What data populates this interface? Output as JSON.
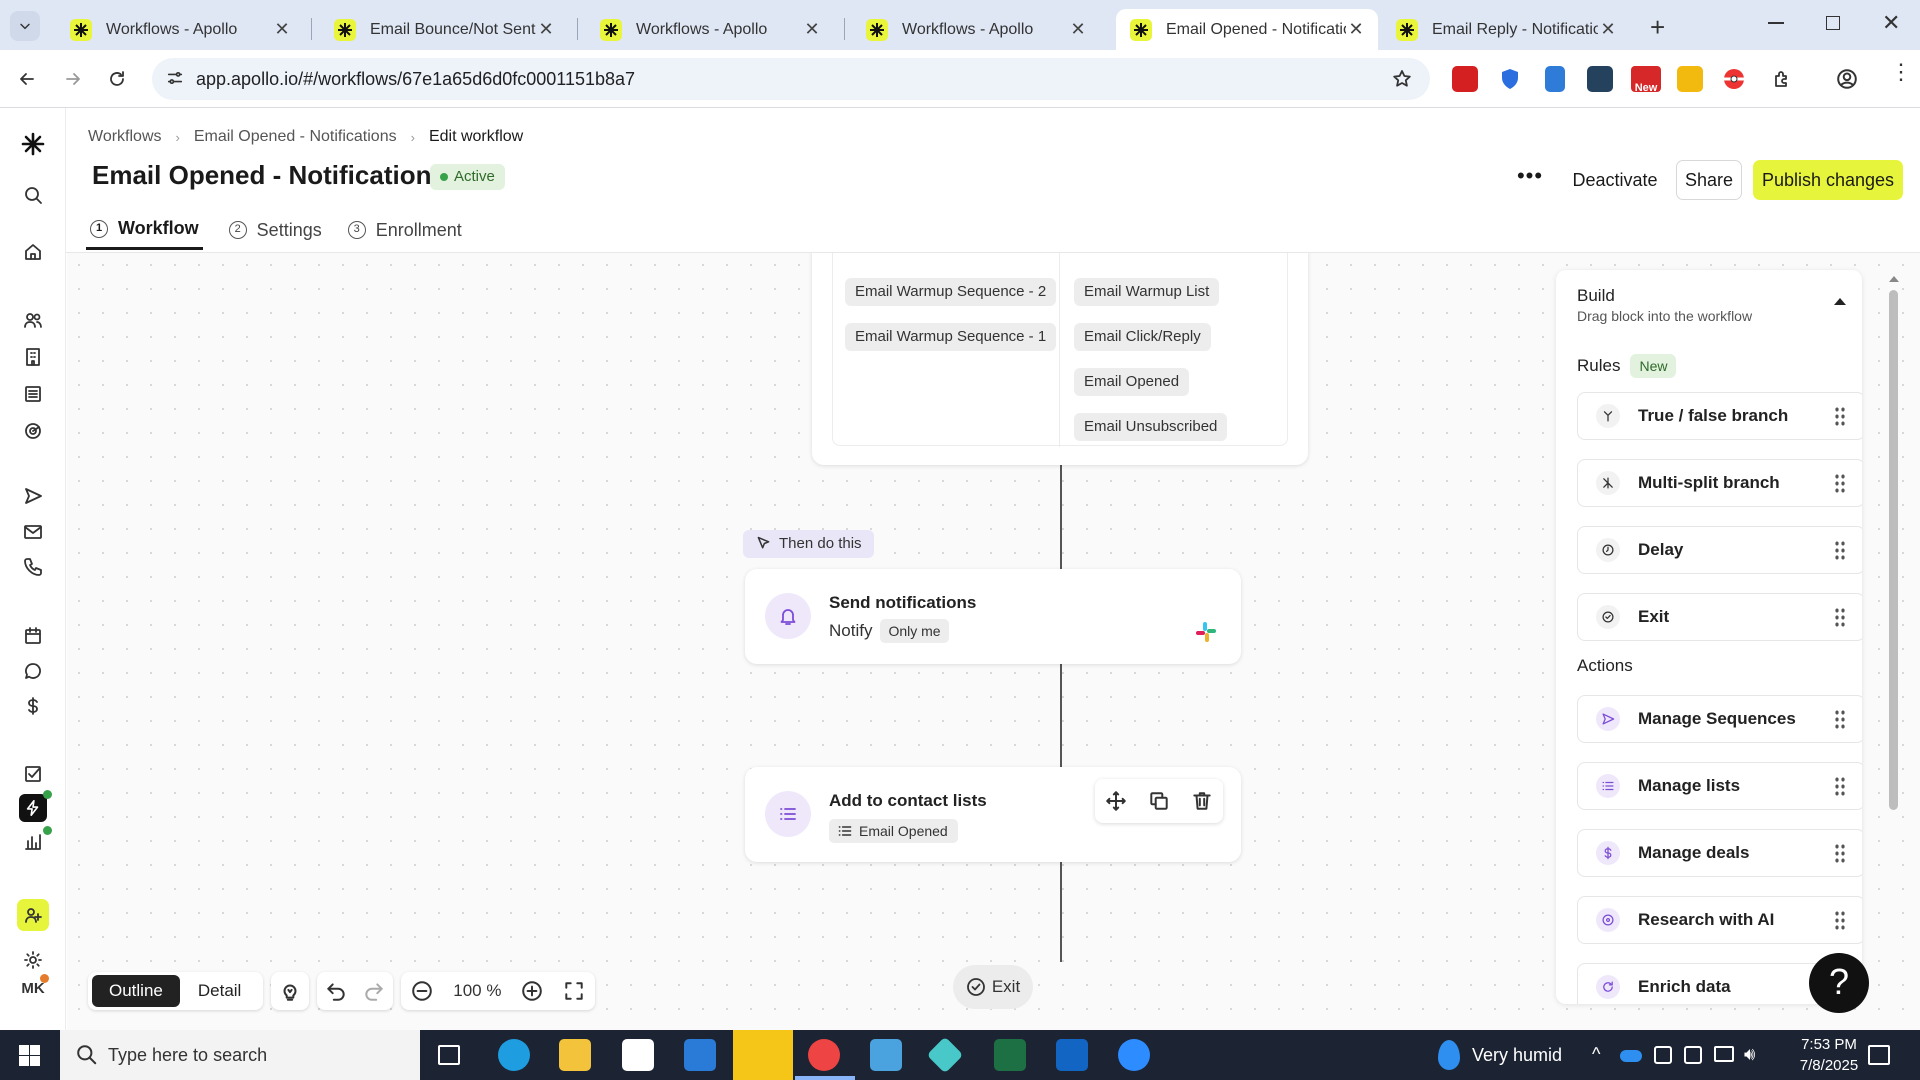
{
  "browser": {
    "tabs": [
      {
        "title": "Workflows - Apollo",
        "active": false
      },
      {
        "title": "Email Bounce/Not Sent - N",
        "active": false
      },
      {
        "title": "Workflows - Apollo",
        "active": false
      },
      {
        "title": "Workflows - Apollo",
        "active": false
      },
      {
        "title": "Email Opened - Notificatio",
        "active": true
      },
      {
        "title": "Email Reply - Notifications",
        "active": false
      }
    ],
    "url": "app.apollo.io/#/workflows/67e1a65d6d0fc0001151b8a7",
    "ext_badge": "New"
  },
  "breadcrumb": [
    "Workflows",
    "Email Opened - Notifications",
    "Edit workflow"
  ],
  "header": {
    "title": "Email Opened - Notifications",
    "status": "Active",
    "deactivate": "Deactivate",
    "share": "Share",
    "publish": "Publish changes"
  },
  "workflow_tabs": [
    {
      "num": "1",
      "label": "Workflow"
    },
    {
      "num": "2",
      "label": "Settings"
    },
    {
      "num": "3",
      "label": "Enrollment"
    }
  ],
  "canvas": {
    "trigger_chips_left": [
      "Email Warmup Sequence - 2",
      "Email Warmup Sequence - 1"
    ],
    "trigger_chips_right": [
      "Email Warmup List",
      "Email Click/Reply",
      "Email Opened",
      "Email Unsubscribed"
    ],
    "then_label": "Then do this",
    "notify": {
      "title": "Send notifications",
      "label": "Notify",
      "chip": "Only me"
    },
    "contact_lists": {
      "title": "Add to contact lists",
      "chip": "Email Opened"
    },
    "exit": "Exit"
  },
  "toolbar": {
    "outline": "Outline",
    "detail": "Detail",
    "zoom": "100 %"
  },
  "panel": {
    "title": "Build",
    "subtitle": "Drag block into the workflow",
    "rules_label": "Rules",
    "rules_badge": "New",
    "rules": [
      "True / false branch",
      "Multi-split branch",
      "Delay",
      "Exit"
    ],
    "actions_label": "Actions",
    "actions": [
      "Manage Sequences",
      "Manage lists",
      "Manage deals",
      "Research with AI",
      "Enrich data"
    ]
  },
  "help": "?",
  "user_initials": "MK",
  "taskbar": {
    "search_placeholder": "Type here to search",
    "weather": "Very humid",
    "time": "7:53 PM",
    "date": "7/8/2025"
  },
  "colors": {
    "publish_bg": "#e6f53c",
    "active_green": "#37a24a",
    "accent_purple": "#7c4dd6"
  }
}
